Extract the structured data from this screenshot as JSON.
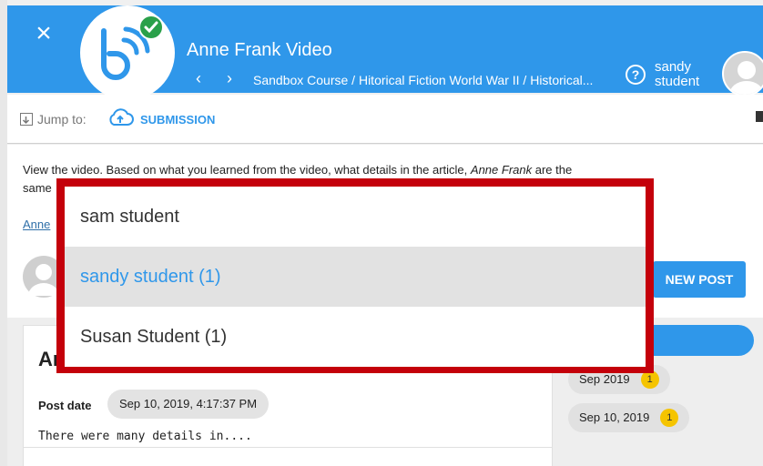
{
  "header": {
    "title": "Anne Frank Video",
    "breadcrumb": "Sandbox Course / Hitorical Fiction World War II / Historical...",
    "user_name": "sandy student",
    "close_icon": "close-icon",
    "help_icon": "help-icon",
    "logo_icon": "app-logo-icon"
  },
  "toolbar": {
    "jump_label": "Jump to:",
    "submission_label": "SUBMISSION"
  },
  "content": {
    "instructions_html_line1": "View the video.  Based on what you learned from the video, what details in the article,",
    "instructions_italic": "Anne Frank",
    "instructions_line1_end": "are the",
    "instructions_line2": "same",
    "link_text": "Anne",
    "new_post_label": "NEW POST"
  },
  "post": {
    "title": "An",
    "date_label": "Post date",
    "date_value": "Sep 10, 2019, 4:17:37 PM",
    "body": "There were many details in...."
  },
  "side": {
    "dates": [
      {
        "label": "Sep 2019",
        "count": "1"
      },
      {
        "label": "Sep 10, 2019",
        "count": "1"
      }
    ]
  },
  "dropdown": {
    "options": [
      {
        "label": "sam student"
      },
      {
        "label": "sandy student (1)"
      },
      {
        "label": "Susan Student (1)"
      }
    ],
    "selected_index": 1
  },
  "colors": {
    "brand_blue": "#2f97ea",
    "highlight_red": "#c4000b",
    "badge_yellow": "#f5c400",
    "check_green": "#2aa04a"
  }
}
